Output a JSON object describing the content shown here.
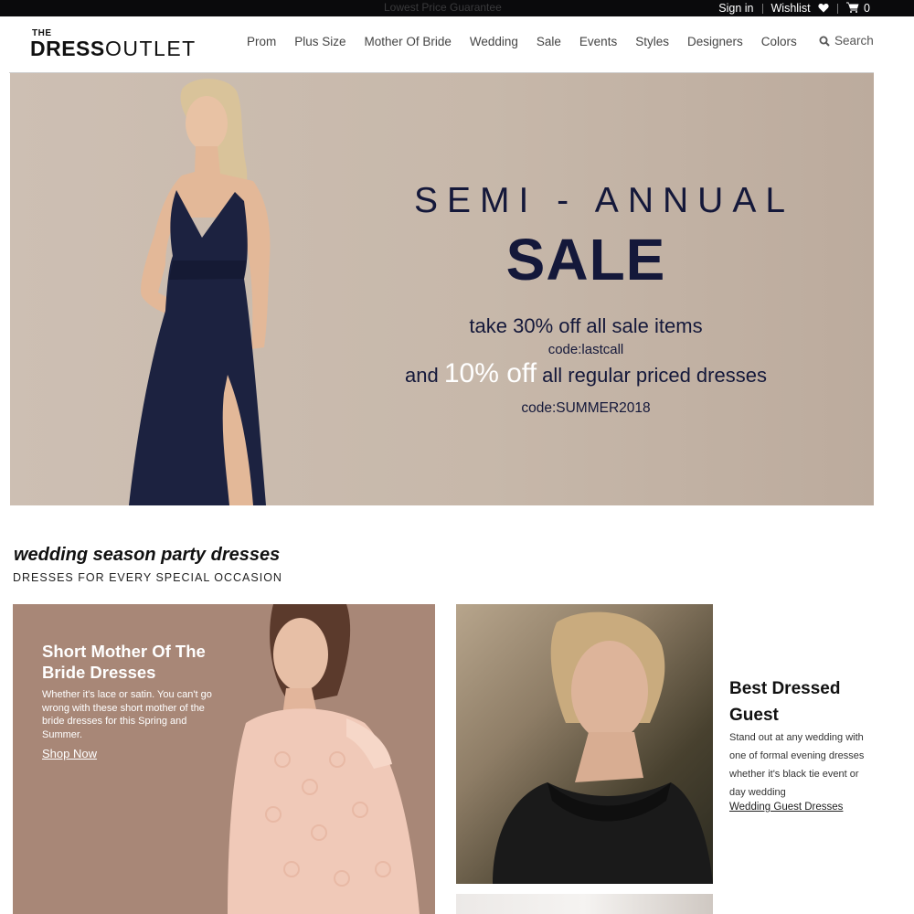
{
  "topbar": {
    "promo": "Lowest Price Guarantee",
    "sign_in": "Sign in",
    "wishlist": "Wishlist",
    "cart_count": "0"
  },
  "header": {
    "logo_the": "THE",
    "logo_dress": "DRESS",
    "logo_outlet": "OUTLET",
    "nav": [
      "Prom",
      "Plus Size",
      "Mother Of Bride",
      "Wedding",
      "Sale",
      "Events",
      "Styles",
      "Designers",
      "Colors"
    ],
    "search_label": "Search"
  },
  "hero": {
    "line1": "SEMI - ANNUAL",
    "line2": "SALE",
    "line3": "take 30% off all sale items",
    "code1": "code:lastcall",
    "line5_pre": "and ",
    "line5_big": "10% off",
    "line5_post": " all regular priced dresses",
    "code2": "code:SUMMER2018"
  },
  "section": {
    "title": "wedding season party dresses",
    "subtitle": "DRESSES FOR EVERY SPECIAL OCCASION"
  },
  "card1": {
    "title": "Short Mother Of The Bride Dresses",
    "desc": "Whether it's lace or satin. You can't go wrong with these short mother of the bride dresses for this Spring and Summer.",
    "cta": "Shop Now"
  },
  "card2": {
    "title": "Best Dressed Guest",
    "desc": "Stand out at any wedding with one of formal evening dresses whether it's black tie event or day wedding",
    "cta": "Wedding Guest Dresses"
  },
  "colors": {
    "topbar_bg": "#0a0a0c",
    "hero_bg": "#c7b8aa",
    "hero_text": "#14183a",
    "card1_bg": "#a88777"
  },
  "icons": [
    "heart-icon",
    "cart-icon",
    "search-icon"
  ]
}
